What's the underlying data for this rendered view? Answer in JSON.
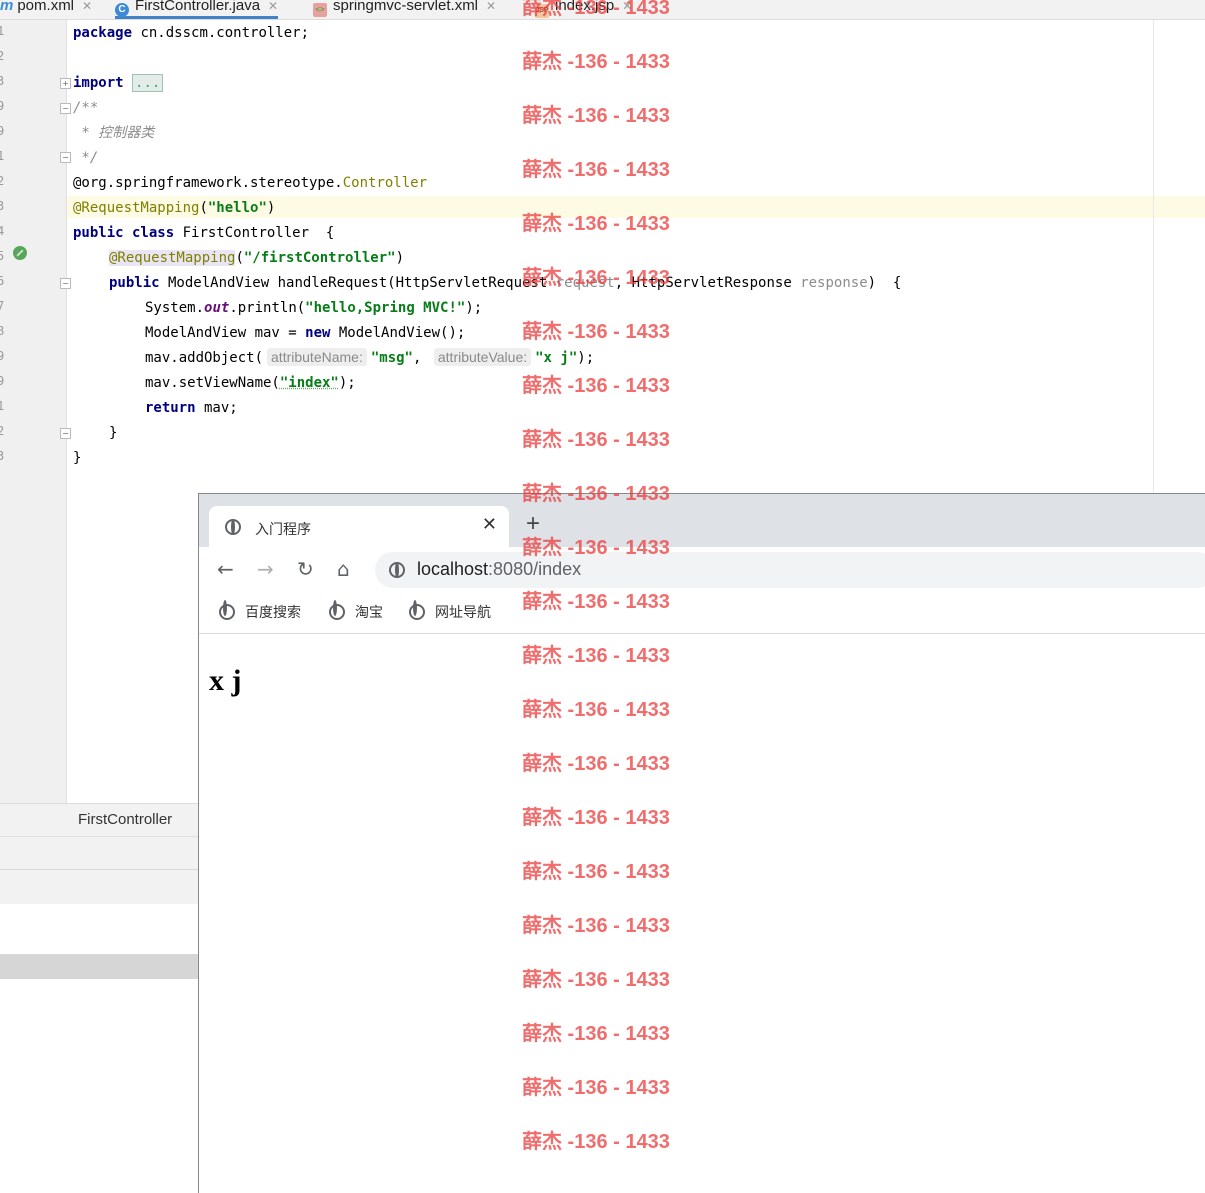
{
  "ide": {
    "tabs": [
      {
        "label": "pom.xml",
        "icon": "maven-icon",
        "active": false
      },
      {
        "label": "FirstController.java",
        "icon": "java-class-icon",
        "active": true
      },
      {
        "label": "springmvc-servlet.xml",
        "icon": "xml-icon",
        "active": false
      },
      {
        "label": "index.jsp",
        "icon": "jsp-icon",
        "active": false
      }
    ],
    "line_numbers": [
      "1",
      "2",
      "3",
      "9",
      "9",
      "1",
      "2",
      "3",
      "4",
      "5",
      "6",
      "7",
      "8",
      "9",
      "9",
      "1",
      "2",
      "3"
    ],
    "code": {
      "package_kw": "package",
      "package_name": " cn.dsscm.controller;",
      "import_kw": "import",
      "import_fold": "...",
      "comment_open": "/**",
      "comment_body": " * 控制器类",
      "comment_close": " */",
      "ann_controller_prefix": "@org.springframework.stereotype.",
      "ann_controller_name": "Controller",
      "ann_mapping": "@RequestMapping",
      "ann_mapping_open": "(",
      "ann_mapping_value": "\"hello\"",
      "ann_mapping_close": ")",
      "class_kw": "public class",
      "class_name": " FirstController  {",
      "method_ann": "@RequestMapping",
      "method_ann_open": "(",
      "method_ann_value": "\"/firstController\"",
      "method_ann_close": ")",
      "method_kw": "public",
      "method_sig_a": " ModelAndView handleRequest(HttpServletRequest ",
      "method_param1": "request",
      "method_sig_b": ", HttpServletResponse ",
      "method_param2": "response",
      "method_sig_c": ")  {",
      "println_a": "System.",
      "println_out": "out",
      "println_b": ".println(",
      "println_str": "\"hello,Spring MVC!\"",
      "println_c": ");",
      "mav_a": "ModelAndView mav = ",
      "mav_new": "new",
      "mav_b": " ModelAndView();",
      "add_a": "mav.addObject(",
      "add_hint1": "attributeName:",
      "add_str1": "\"msg\"",
      "add_comma": ",",
      "add_hint2": "attributeValue:",
      "add_str2": "\"x j\"",
      "add_c": ");",
      "view_a": "mav.setViewName(",
      "view_str": "\"index\"",
      "view_c": ");",
      "return_kw": "return",
      "return_b": " mav;",
      "close_method": "}",
      "close_class": "}"
    },
    "breadcrumb": "FirstController"
  },
  "browser": {
    "tab_title": "入门程序",
    "tab_close": "✕",
    "new_tab": "+",
    "url_host": "localhost",
    "url_rest": ":8080/index",
    "bookmarks": [
      "百度搜索",
      "淘宝",
      "网址导航"
    ],
    "page_text": "x j"
  },
  "watermark": {
    "text": "薛杰 -136 - 1433"
  },
  "colors": {
    "keyword": "#000080",
    "string": "#067d17",
    "annotation": "#808000",
    "watermark": "#eb3c3c",
    "active_tab_underline": "#4083c9"
  }
}
